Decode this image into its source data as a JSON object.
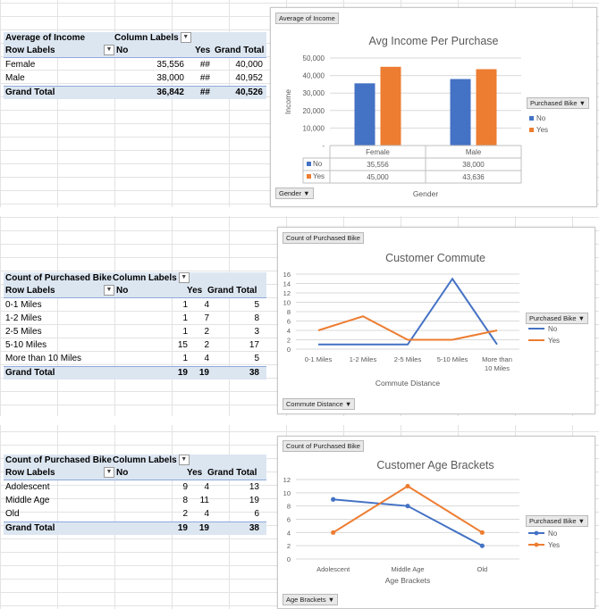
{
  "colors": {
    "no": "#4472c4",
    "yes": "#ed7d31",
    "header": "#dce6f1"
  },
  "icons": {
    "dropdown": "chevron-down-icon"
  },
  "pivot1": {
    "title": "Average of Income",
    "col_labels": "Column Labels",
    "row_labels": "Row Labels",
    "col_no": "No",
    "col_yes": "Yes",
    "col_total": "Grand Total",
    "rows": [
      {
        "label": "Female",
        "no": "35,556",
        "yes": "##",
        "total": "40,000"
      },
      {
        "label": "Male",
        "no": "38,000",
        "yes": "##",
        "total": "40,952"
      }
    ],
    "grand": {
      "label": "Grand Total",
      "no": "36,842",
      "yes": "##",
      "total": "40,526"
    }
  },
  "pivot2": {
    "title": "Count of Purchased Bike",
    "col_labels": "Column Labels",
    "row_labels": "Row Labels",
    "col_no": "No",
    "col_yes": "Yes",
    "col_total": "Grand Total",
    "rows": [
      {
        "label": "0-1 Miles",
        "no": "1",
        "yes": "4",
        "total": "5"
      },
      {
        "label": "1-2 Miles",
        "no": "1",
        "yes": "7",
        "total": "8"
      },
      {
        "label": "2-5 Miles",
        "no": "1",
        "yes": "2",
        "total": "3"
      },
      {
        "label": "5-10 Miles",
        "no": "15",
        "yes": "2",
        "total": "17"
      },
      {
        "label": "More than 10 Miles",
        "no": "1",
        "yes": "4",
        "total": "5"
      }
    ],
    "grand": {
      "label": "Grand Total",
      "no": "19",
      "yes": "19",
      "total": "38"
    }
  },
  "pivot3": {
    "title": "Count of Purchased Bike",
    "col_labels": "Column Labels",
    "row_labels": "Row Labels",
    "col_no": "No",
    "col_yes": "Yes",
    "col_total": "Grand Total",
    "rows": [
      {
        "label": "Adolescent",
        "no": "9",
        "yes": "4",
        "total": "13"
      },
      {
        "label": "Middle Age",
        "no": "8",
        "yes": "11",
        "total": "19"
      },
      {
        "label": "Old",
        "no": "2",
        "yes": "4",
        "total": "6"
      }
    ],
    "grand": {
      "label": "Grand Total",
      "no": "19",
      "yes": "19",
      "total": "38"
    }
  },
  "chart1_ui": {
    "top_button": "Average of Income",
    "bottom_button": "Gender",
    "legend_button": "Purchased Bike"
  },
  "chart2_ui": {
    "top_button": "Count of Purchased Bike",
    "bottom_button": "Commute Distance",
    "legend_button": "Purchased Bike"
  },
  "chart3_ui": {
    "top_button": "Count of Purchased Bike",
    "bottom_button": "Age Brackets",
    "legend_button": "Purchased Bike"
  },
  "chart_data": [
    {
      "type": "bar",
      "title": "Avg Income Per Purchase",
      "xlabel": "Gender",
      "ylabel": "Income",
      "categories": [
        "Female",
        "Male"
      ],
      "ylim": [
        0,
        50000
      ],
      "yticks": [
        "-",
        "10,000",
        "20,000",
        "30,000",
        "40,000",
        "50,000"
      ],
      "series": [
        {
          "name": "No",
          "values": [
            35556,
            38000
          ],
          "labels": [
            "35,556",
            "38,000"
          ]
        },
        {
          "name": "Yes",
          "values": [
            45000,
            43636
          ],
          "labels": [
            "45,000",
            "43,636"
          ]
        }
      ],
      "legend": "right",
      "grid": true
    },
    {
      "type": "line",
      "title": "Customer Commute",
      "xlabel": "Commute Distance",
      "ylabel": "",
      "categories": [
        "0-1 Miles",
        "1-2 Miles",
        "2-5 Miles",
        "5-10 Miles",
        "More than 10 Miles"
      ],
      "ylim": [
        0,
        16
      ],
      "yticks": [
        "0",
        "2",
        "4",
        "6",
        "8",
        "10",
        "12",
        "14",
        "16"
      ],
      "series": [
        {
          "name": "No",
          "values": [
            1,
            1,
            1,
            15,
            1
          ]
        },
        {
          "name": "Yes",
          "values": [
            4,
            7,
            2,
            2,
            4
          ]
        }
      ],
      "legend": "right",
      "grid": true
    },
    {
      "type": "line",
      "title": "Customer Age Brackets",
      "xlabel": "Age Brackets",
      "ylabel": "",
      "categories": [
        "Adolescent",
        "Middle Age",
        "Old"
      ],
      "ylim": [
        0,
        12
      ],
      "yticks": [
        "0",
        "2",
        "4",
        "6",
        "8",
        "10",
        "12"
      ],
      "series": [
        {
          "name": "No",
          "values": [
            9,
            8,
            2
          ]
        },
        {
          "name": "Yes",
          "values": [
            4,
            11,
            4
          ]
        }
      ],
      "legend": "right",
      "grid": true
    }
  ]
}
